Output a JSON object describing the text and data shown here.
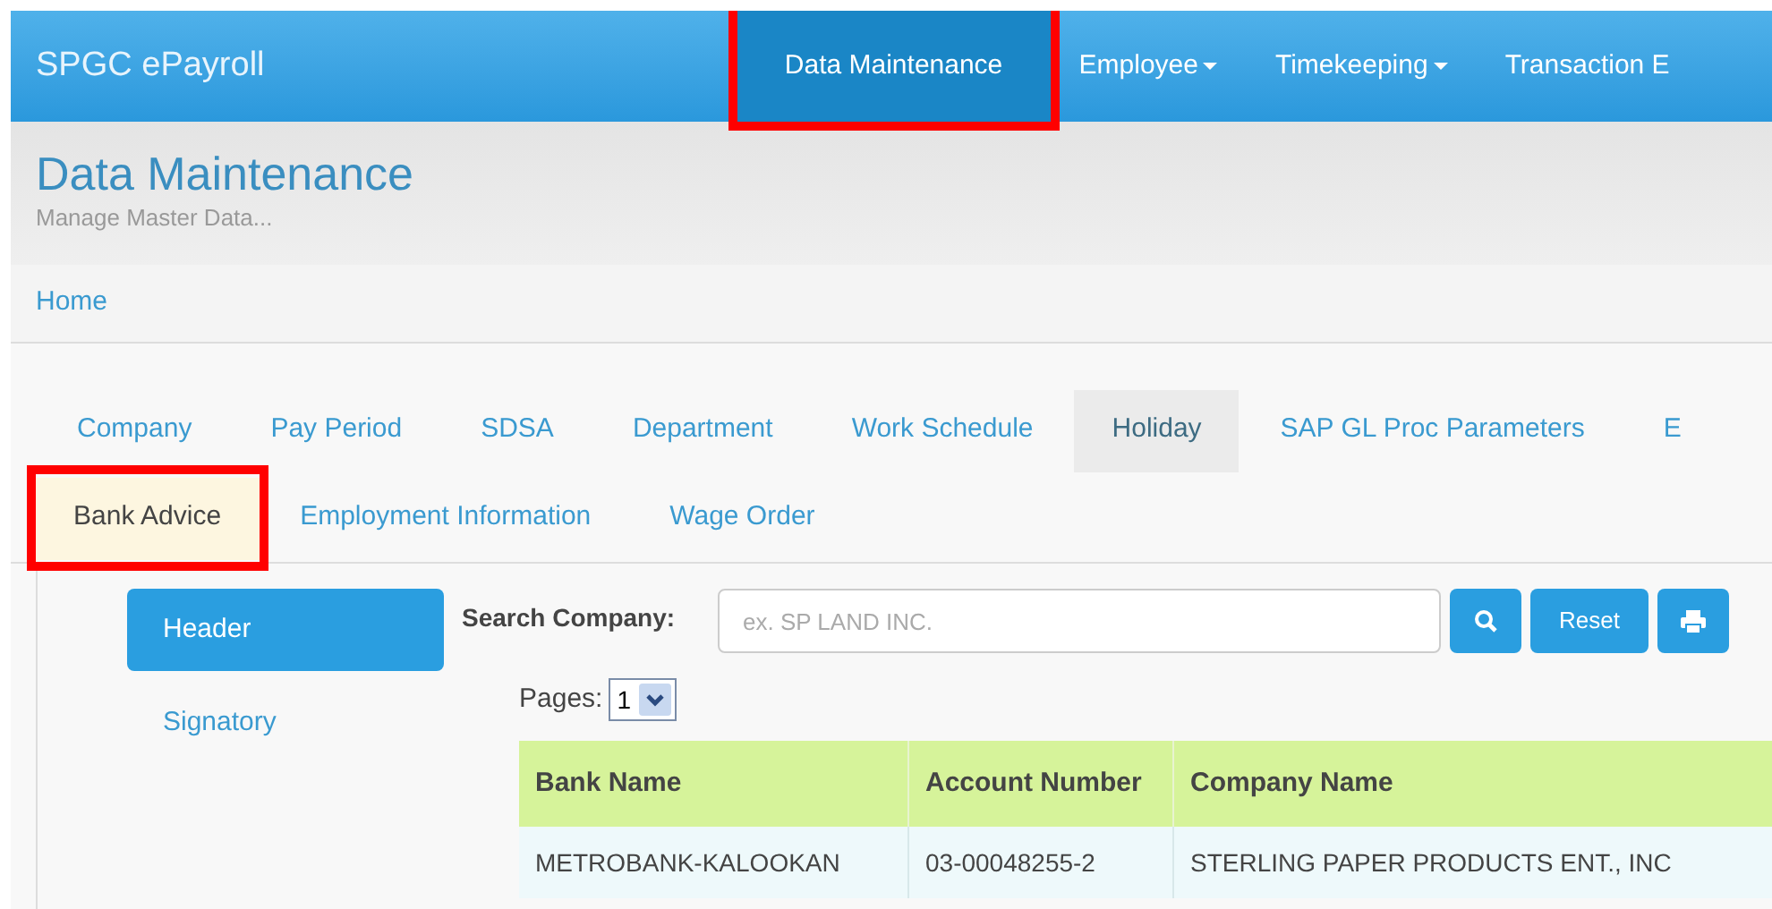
{
  "navbar": {
    "brand": "SPGC ePayroll",
    "items": [
      {
        "label": "Data Maintenance",
        "selected": true,
        "dropdown": false,
        "highlighted": true
      },
      {
        "label": "Employee",
        "selected": false,
        "dropdown": true,
        "highlighted": false
      },
      {
        "label": "Timekeeping",
        "selected": false,
        "dropdown": true,
        "highlighted": false
      },
      {
        "label": "Transaction E",
        "selected": false,
        "dropdown": false,
        "highlighted": false
      }
    ]
  },
  "page_header": {
    "title": "Data Maintenance",
    "subtitle": "Manage Master Data..."
  },
  "breadcrumb": [
    "Home"
  ],
  "tab_rows": [
    [
      {
        "label": "Company",
        "selected": false,
        "shaded": false,
        "highlighted": false
      },
      {
        "label": "Pay Period",
        "selected": false,
        "shaded": false,
        "highlighted": false
      },
      {
        "label": "SDSA",
        "selected": false,
        "shaded": false,
        "highlighted": false
      },
      {
        "label": "Department",
        "selected": false,
        "shaded": false,
        "highlighted": false
      },
      {
        "label": "Work Schedule",
        "selected": false,
        "shaded": false,
        "highlighted": false
      },
      {
        "label": "Holiday",
        "selected": false,
        "shaded": true,
        "highlighted": false
      },
      {
        "label": "SAP GL Proc Parameters",
        "selected": false,
        "shaded": false,
        "highlighted": false
      },
      {
        "label": "E",
        "selected": false,
        "shaded": false,
        "highlighted": false
      }
    ],
    [
      {
        "label": "Bank Advice",
        "selected": true,
        "shaded": false,
        "highlighted": true
      },
      {
        "label": "Employment Information",
        "selected": false,
        "shaded": false,
        "highlighted": false
      },
      {
        "label": "Wage Order",
        "selected": false,
        "shaded": false,
        "highlighted": false
      }
    ]
  ],
  "side_menu": [
    {
      "label": "Header",
      "selected": true
    },
    {
      "label": "Signatory",
      "selected": false
    }
  ],
  "search": {
    "label": "Search Company:",
    "placeholder": "ex. SP LAND INC.",
    "reset_button": "Reset"
  },
  "pages": {
    "label": "Pages:",
    "value": "1"
  },
  "table": {
    "columns": [
      "Bank Name",
      "Account Number",
      "Company Name"
    ],
    "rows": [
      [
        "METROBANK-KALOOKAN",
        "03-00048255-2",
        "STERLING PAPER PRODUCTS ENT., INC"
      ]
    ]
  }
}
